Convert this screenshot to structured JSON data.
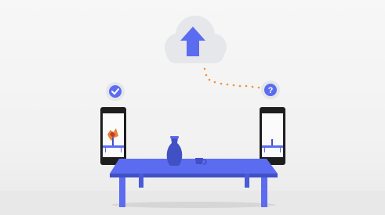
{
  "scene": {
    "cloud": {
      "icon": "upload-arrow-icon"
    },
    "left_phone": {
      "status_icon": "checkmark-icon",
      "status": "synced"
    },
    "right_phone": {
      "status_icon": "question-mark-icon",
      "status": "unknown"
    },
    "table_items": [
      "vase",
      "cup"
    ],
    "colors": {
      "accent": "#5b6cf0",
      "accent_dark": "#4150c4",
      "badge": "#e4e6ea",
      "cloud": "#e6e7ea",
      "dots": "#f0913a",
      "phone_body": "#1e1e1e",
      "shadow": "#d6d6d6"
    }
  }
}
